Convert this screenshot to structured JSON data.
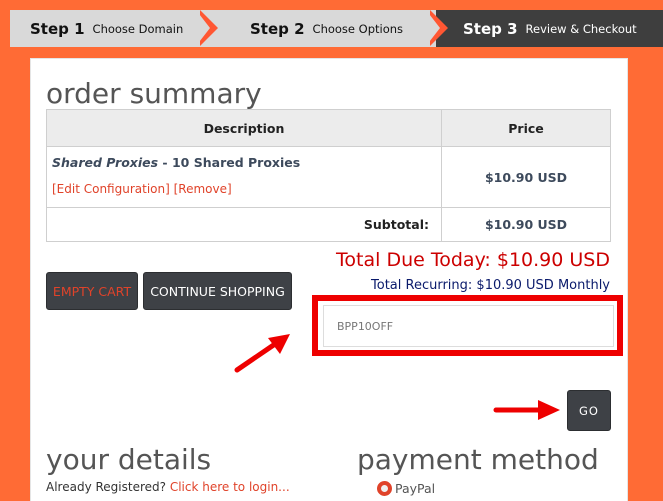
{
  "steps": [
    {
      "num": "Step 1",
      "label": "Choose Domain"
    },
    {
      "num": "Step 2",
      "label": "Choose Options"
    },
    {
      "num": "Step 3",
      "label": "Review & Checkout"
    }
  ],
  "order_summary": {
    "heading": "order summary",
    "columns": [
      "Description",
      "Price"
    ],
    "item": {
      "product_group": "Shared Proxies",
      "product_separator": " - ",
      "product_name": "10 Shared Proxies",
      "edit_link": "[Edit Configuration]",
      "remove_link": "[Remove]",
      "price": "$10.90 USD"
    },
    "subtotal_label": "Subtotal:",
    "subtotal_value": "$10.90 USD",
    "total_due": "Total Due Today: $10.90 USD",
    "total_recurring": "Total Recurring: $10.90 USD Monthly"
  },
  "buttons": {
    "empty_cart": "EMPTY CART",
    "continue_shopping": "CONTINUE SHOPPING",
    "go": "GO"
  },
  "promo": {
    "value": "BPP10OFF"
  },
  "your_details": {
    "heading": "your details",
    "already_registered": "Already Registered?",
    "login_link": "Click here to login..."
  },
  "payment": {
    "heading": "payment method",
    "option": "PayPal"
  },
  "colors": {
    "page_background": "#ff6b35",
    "step_active": "#3e3e3e",
    "step_inactive": "#d9d9d9",
    "step_chevron": "#ff5733",
    "total_due": "#cc0000",
    "total_recurring": "#0a1a6b",
    "link": "#e0432a",
    "highlight_box": "#ee0000",
    "annotation_arrow": "#ee0000"
  }
}
